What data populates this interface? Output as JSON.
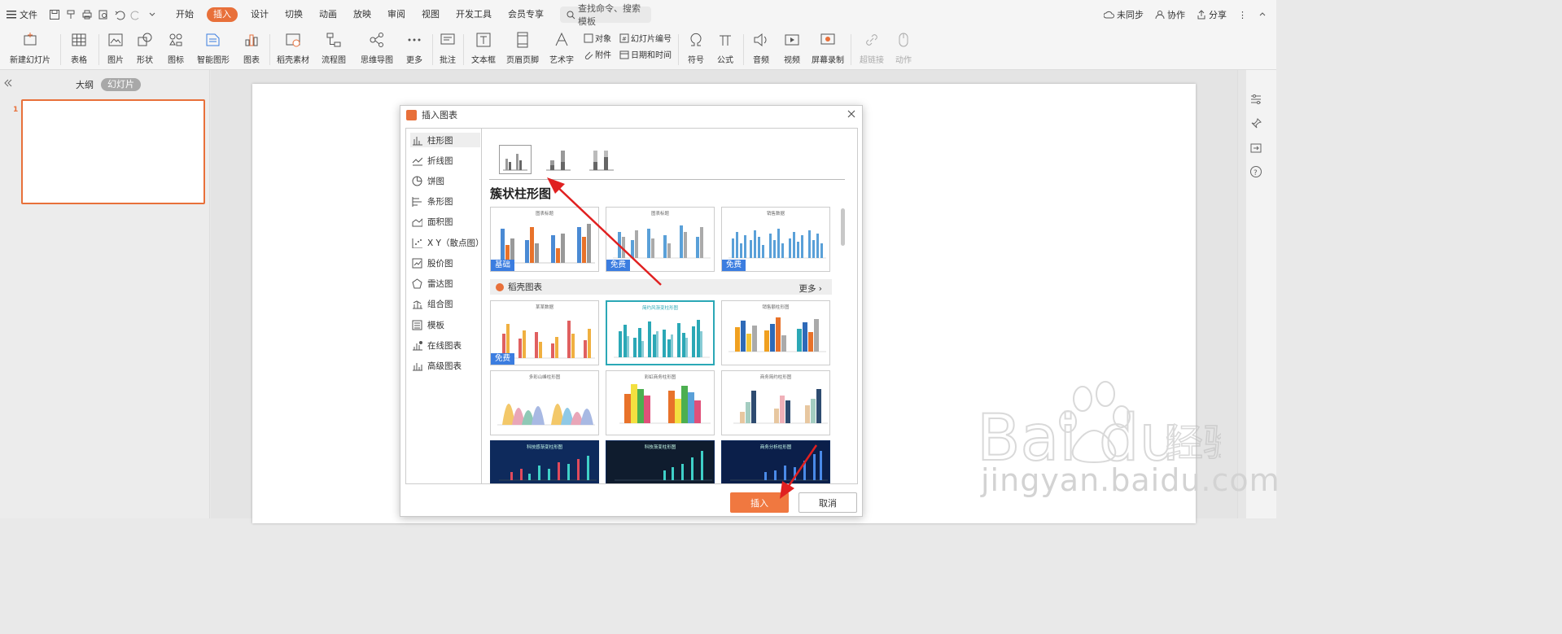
{
  "toolbar": {
    "file": "文件",
    "tabs": [
      "开始",
      "插入",
      "设计",
      "切换",
      "动画",
      "放映",
      "审阅",
      "视图",
      "开发工具",
      "会员专享"
    ],
    "active_tab": "插入",
    "search_placeholder": "查找命令、搜索模板",
    "right": {
      "sync": "未同步",
      "collab": "协作",
      "share": "分享"
    }
  },
  "ribbon": {
    "new_slide": "新建幻灯片",
    "table": "表格",
    "picture": "图片",
    "shape": "形状",
    "icon": "图标",
    "smart_graphic": "智能图形",
    "chart": "图表",
    "docer_material": "稻壳素材",
    "flowchart": "流程图",
    "mindmap": "思维导图",
    "more": "更多",
    "comment": "批注",
    "textbox": "文本框",
    "header_footer": "页眉页脚",
    "wordart": "艺术字",
    "object": "对象",
    "attachment": "附件",
    "slide_number": "幻灯片编号",
    "datetime": "日期和时间",
    "symbol": "符号",
    "formula": "公式",
    "audio": "音频",
    "video": "视频",
    "screen_record": "屏幕录制",
    "hyperlink": "超链接",
    "action": "动作"
  },
  "left_panel": {
    "outline_tab": "大纲",
    "slides_tab": "幻灯片",
    "slide_number": "1"
  },
  "dialog": {
    "title": "插入图表",
    "categories": [
      "柱形图",
      "折线图",
      "饼图",
      "条形图",
      "面积图",
      "X Y（散点图）",
      "股价图",
      "雷达图",
      "组合图",
      "模板",
      "在线图表",
      "高级图表"
    ],
    "active_category": "柱形图",
    "section_title": "簇状柱形图",
    "basic_badge": "基础",
    "free_badge": "免费",
    "docer_section": "稻壳图表",
    "more_link": "更多",
    "basic_cards": [
      {
        "title": "图表标题",
        "badge": "基础"
      },
      {
        "title": "图表标题",
        "badge": "免费"
      },
      {
        "title": "销售数据",
        "badge": "免费"
      }
    ],
    "docer_cards": [
      {
        "title": "某某数据",
        "badge": "免费"
      },
      {
        "title": "简约风渐变柱形图",
        "badge": ""
      },
      {
        "title": "销售额柱形图",
        "badge": ""
      },
      {
        "title": "多彩山峰柱形图",
        "badge": ""
      },
      {
        "title": "彩虹商务柱形图",
        "badge": ""
      },
      {
        "title": "商务简约柱形图",
        "badge": ""
      },
      {
        "title": "科技感渐变柱形图",
        "badge": ""
      },
      {
        "title": "科技渐变柱形图",
        "badge": ""
      },
      {
        "title": "商务分析柱形图",
        "badge": ""
      }
    ],
    "insert_button": "插入",
    "cancel_button": "取消"
  },
  "watermark": {
    "brand": "Baidu经验",
    "url": "jingyan.baidu.com"
  },
  "colors": {
    "accent": "#e8703a",
    "badge_blue": "#3b7de0",
    "dark_card": "#0e2a5c",
    "selected_teal": "#2ba8b6"
  }
}
